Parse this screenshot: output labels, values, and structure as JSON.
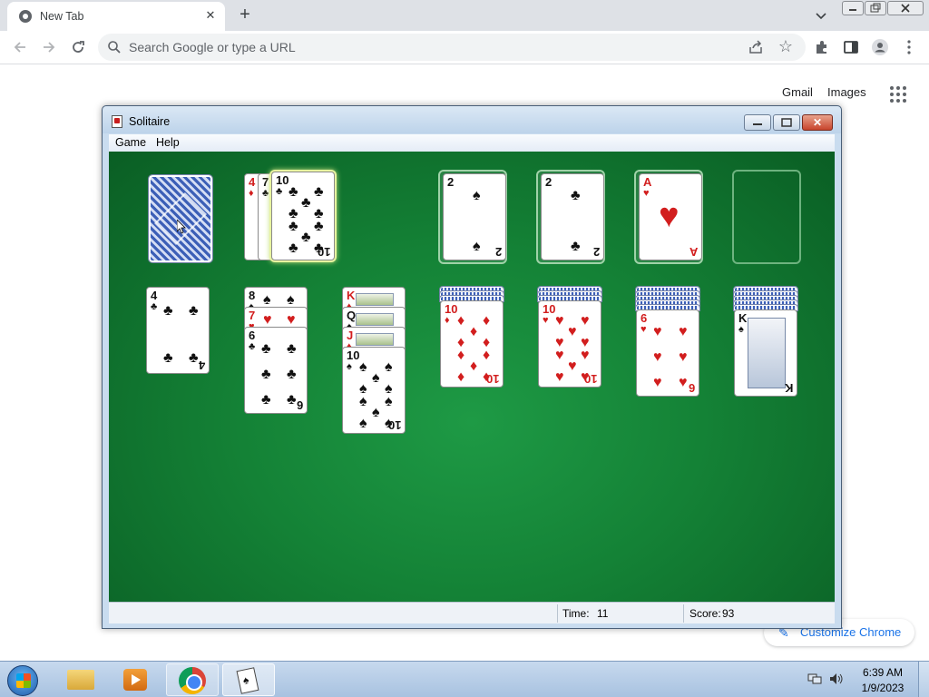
{
  "browser": {
    "tab": {
      "title": "New Tab",
      "close": "✕"
    },
    "new_tab": "+",
    "omnibox": {
      "placeholder": "Search Google or type a URL",
      "value": ""
    },
    "ntp": {
      "gmail": "Gmail",
      "images": "Images",
      "customize": "Customize Chrome"
    }
  },
  "solitaire": {
    "title": "Solitaire",
    "menu": [
      "Game",
      "Help"
    ],
    "status": {
      "time_label": "Time:",
      "time": "11",
      "score_label": "Score:",
      "score": "93"
    },
    "stock": {
      "face": "down"
    },
    "waste": [
      {
        "rank": "4",
        "suit": "♦",
        "color": "red"
      },
      {
        "rank": "7",
        "suit": "♣",
        "color": "black"
      },
      {
        "rank": "10",
        "suit": "♣",
        "color": "black"
      }
    ],
    "foundations": [
      {
        "rank": "2",
        "suit": "♠",
        "color": "black"
      },
      {
        "rank": "2",
        "suit": "♣",
        "color": "black"
      },
      {
        "rank": "A",
        "suit": "♥",
        "color": "red"
      },
      {
        "rank": "",
        "suit": "",
        "color": ""
      }
    ],
    "tableau": [
      {
        "hidden": 0,
        "cards": [
          {
            "rank": "4",
            "suit": "♣",
            "color": "black"
          }
        ]
      },
      {
        "hidden": 0,
        "cards": [
          {
            "rank": "8",
            "suit": "♠",
            "color": "black"
          },
          {
            "rank": "7",
            "suit": "♥",
            "color": "red"
          },
          {
            "rank": "6",
            "suit": "♣",
            "color": "black"
          }
        ]
      },
      {
        "hidden": 0,
        "cards": [
          {
            "rank": "K",
            "suit": "♦",
            "color": "red"
          },
          {
            "rank": "Q",
            "suit": "♠",
            "color": "black"
          },
          {
            "rank": "J",
            "suit": "♦",
            "color": "red"
          },
          {
            "rank": "10",
            "suit": "♠",
            "color": "black"
          }
        ]
      },
      {
        "hidden": 3,
        "cards": [
          {
            "rank": "10",
            "suit": "♦",
            "color": "red"
          }
        ]
      },
      {
        "hidden": 3,
        "cards": [
          {
            "rank": "10",
            "suit": "♥",
            "color": "red"
          }
        ]
      },
      {
        "hidden": 5,
        "cards": [
          {
            "rank": "6",
            "suit": "♥",
            "color": "red"
          }
        ]
      },
      {
        "hidden": 5,
        "cards": [
          {
            "rank": "K",
            "suit": "♠",
            "color": "black"
          }
        ]
      }
    ]
  },
  "taskbar": {
    "apps": [
      "Windows Explorer",
      "Windows Media Player",
      "Google Chrome",
      "Solitaire"
    ],
    "clock": {
      "time": "6:39 AM",
      "date": "1/9/2023"
    }
  }
}
